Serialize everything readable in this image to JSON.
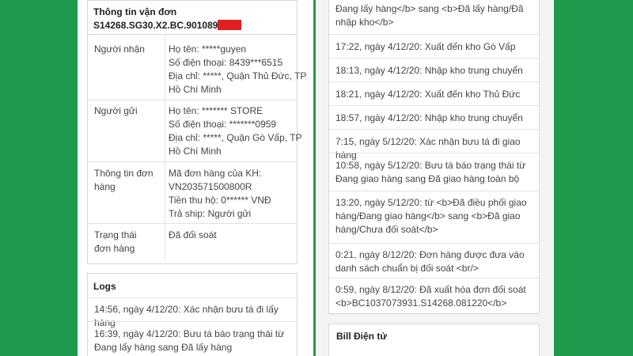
{
  "order": {
    "header_title": "Thông tin vận đơn",
    "code": "S14268.SG30.X2.BC.901089",
    "rows": [
      {
        "label": "Người nhận",
        "lines": [
          "Họ tên: *****guyen",
          "Số điện thoại: 8439***6515",
          "Địa chỉ: *****, Quận Thủ Đức, TP Hồ Chí Minh"
        ]
      },
      {
        "label": "Người gửi",
        "lines": [
          "Họ tên: ******* STORE",
          "Số điện thoại: *******0959",
          "Địa chỉ: *****, Quận Gò Vấp, TP Hồ Chí Minh"
        ]
      },
      {
        "label": "Thông tin đơn hàng",
        "lines": [
          "Mã đơn hàng của KH: VN203571500800R",
          "Tiền thu hộ: 0****** VNĐ",
          "Trả ship: Người gửi"
        ]
      },
      {
        "label": "Trạng thái đơn hàng",
        "lines": [
          "Đã đối soát"
        ]
      }
    ]
  },
  "logs": {
    "title": "Logs",
    "left_entries": [
      "14:56, ngày 4/12/20: Xác nhận bưu tá đi lấy hàng",
      "16:39, ngày 4/12/20: Bưu tá báo trạng thái từ Đang lấy hàng sang Đã lấy hàng"
    ],
    "right_top_partial": "Đang lấy hàng</b> sang <b>Đã lấy hàng/Đã nhập kho</b>",
    "right_entries": [
      "17:22, ngày 4/12/20: Xuất đến kho Gò Vấp",
      "18:13, ngày 4/12/20: Nhập kho trung chuyển",
      "18:21, ngày 4/12/20: Xuất đến kho Thủ Đức",
      "18:57, ngày 4/12/20: Nhập kho trung chuyển",
      "7:15, ngày 5/12/20: Xác nhận bưu tá đi giao hàng",
      "10:58, ngày 5/12/20: Bưu tá báo trạng thái từ Đang giao hàng sang Đã giao hàng toàn bộ",
      "13:20, ngày 5/12/20: từ <b>Đã điều phối giao hàng/Đang giao hàng</b> sang <b>Đã giao hàng/Chưa đối soát</b>",
      "0:21, ngày 8/12/20: Đơn hàng được đưa vào danh sách chuẩn bị đối soát <br/>",
      "0:59, ngày 8/12/20: Đã xuất hóa đơn đối soát <b>BC1037073931.S14268.081220</b>"
    ]
  },
  "bill": {
    "title": "Bill Điện tử"
  },
  "colors": {
    "background": "#1e9a4c",
    "redaction": "#e02020"
  }
}
